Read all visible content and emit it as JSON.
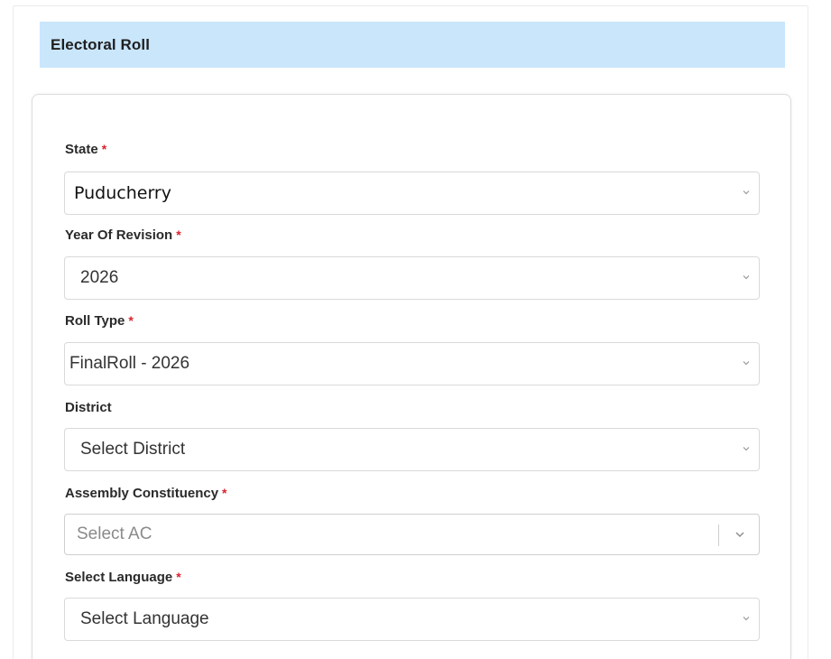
{
  "header": {
    "title": "Electoral Roll"
  },
  "form": {
    "required_mark": "*",
    "state": {
      "label": "State",
      "value": "Puducherry"
    },
    "year_of_revision": {
      "label": "Year Of Revision",
      "value": "2026"
    },
    "roll_type": {
      "label": "Roll Type",
      "value": "FinalRoll - 2026"
    },
    "district": {
      "label": "District",
      "value": "Select District"
    },
    "assembly_constituency": {
      "label": "Assembly Constituency",
      "value": "Select AC"
    },
    "language": {
      "label": "Select Language",
      "value": "Select Language"
    }
  },
  "icons": {
    "select_arrow": "chevron-down-icon"
  },
  "colors": {
    "header_bg": "#c9e6fb",
    "required": "#d9232d"
  }
}
